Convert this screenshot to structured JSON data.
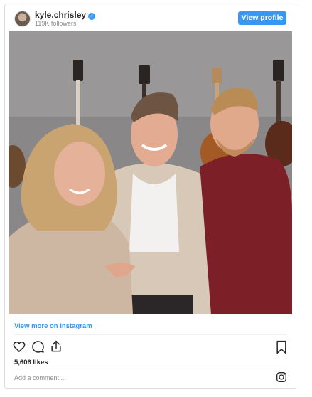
{
  "header": {
    "username": "kyle.chrisley",
    "verified_mark": "✓",
    "followers": "119K followers",
    "view_profile_label": "View profile"
  },
  "photo": {
    "description_icon": "group-photo-image"
  },
  "footer": {
    "view_more_label": "View more on Instagram",
    "likes": "5,606 likes",
    "comment_placeholder": "Add a comment..."
  },
  "colors": {
    "accent": "#3897f0",
    "text": "#262626",
    "muted": "#8e8e8e",
    "border": "#dbdbdb"
  },
  "icons": [
    "heart-icon",
    "comment-icon",
    "share-icon",
    "bookmark-icon",
    "instagram-icon"
  ]
}
